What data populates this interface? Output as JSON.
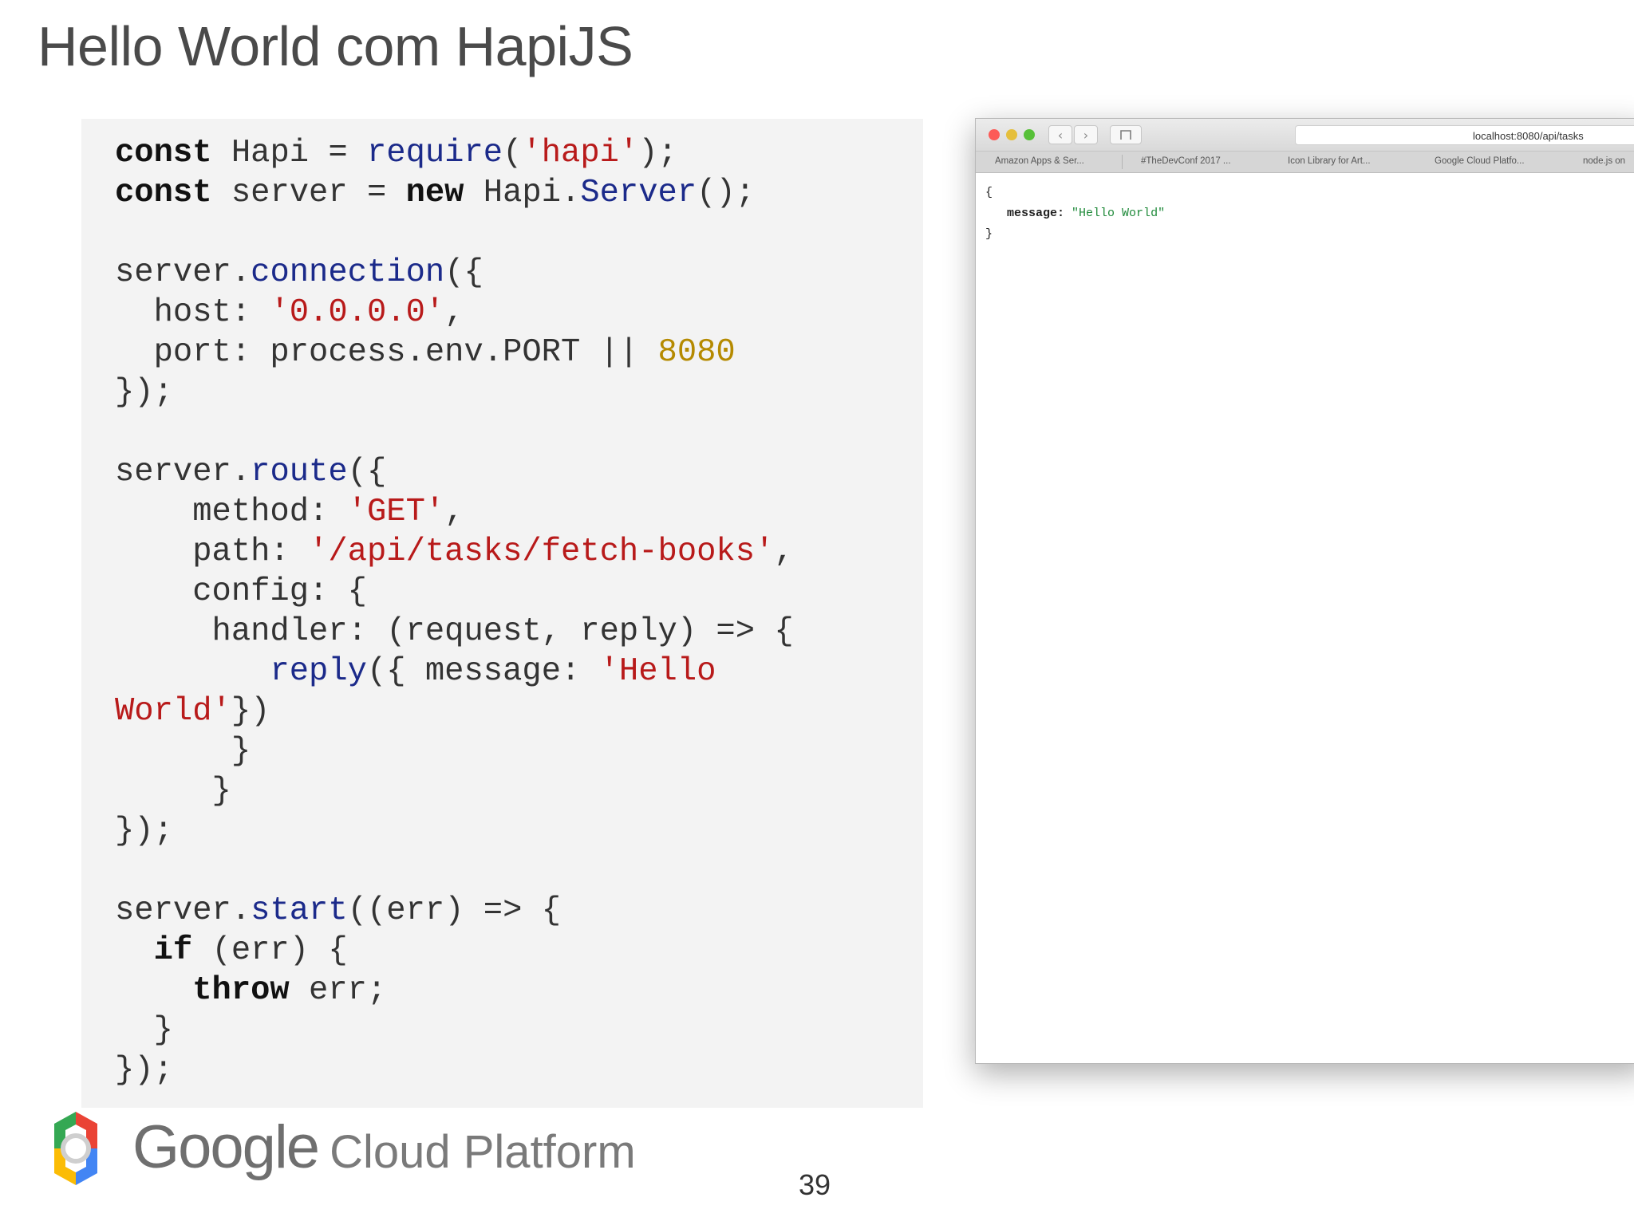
{
  "slide": {
    "title": "Hello World com HapiJS",
    "page_number": "39"
  },
  "code": {
    "language": "javascript",
    "text": "const Hapi = require('hapi');\nconst server = new Hapi.Server();\n\nserver.connection({\n  host: '0.0.0.0',\n  port: process.env.PORT || 8080\n});\n\nserver.route({\n    method: 'GET',\n    path: '/api/tasks/fetch-books',\n    config: {\n     handler: (request, reply) => {\n        reply({ message: 'Hello\nWorld'})\n      }\n     }\n});\n\nserver.start((err) => {\n  if (err) {\n    throw err;\n  }\n});"
  },
  "browser": {
    "address": "localhost:8080/api/tasks",
    "bookmarks": [
      "Amazon Apps & Ser...",
      "#TheDevConf 2017 ...",
      "Icon Library for Art...",
      "Google Cloud Platfo...",
      "node.js on"
    ],
    "response": {
      "open_brace": "{",
      "key": "message:",
      "value": "\"Hello World\"",
      "close_brace": "}"
    }
  },
  "branding": {
    "google": "Google",
    "cloud_platform": "Cloud Platform",
    "logo_colors": [
      "#ea4335",
      "#fbbc05",
      "#34a853",
      "#4285f4"
    ]
  }
}
